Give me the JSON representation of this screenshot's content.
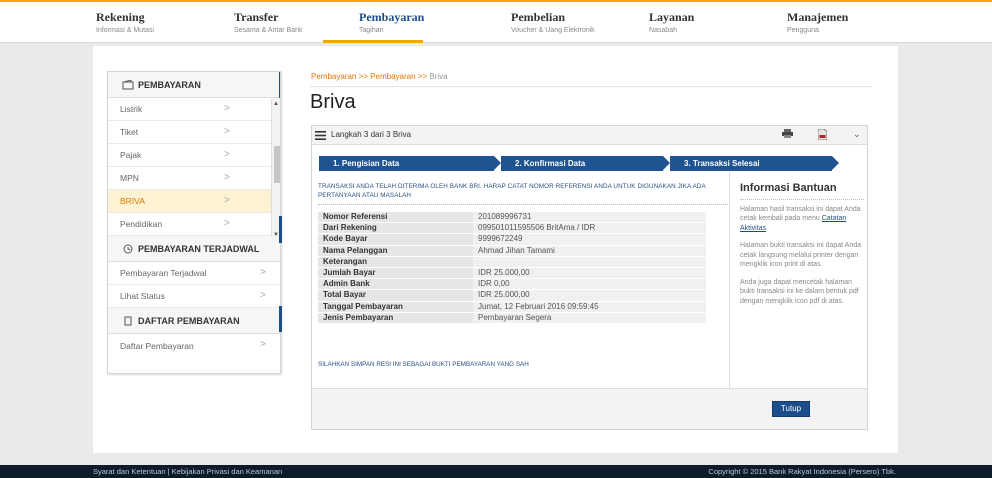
{
  "nav": [
    {
      "title": "Rekening",
      "sub": "Informasi & Mutasi"
    },
    {
      "title": "Transfer",
      "sub": "Sesama & Antar Bank"
    },
    {
      "title": "Pembayaran",
      "sub": "Tagihan"
    },
    {
      "title": "Pembelian",
      "sub": "Voucher & Uang Elektronik"
    },
    {
      "title": "Layanan",
      "sub": "Nasabah"
    },
    {
      "title": "Manajemen",
      "sub": "Pengguna"
    }
  ],
  "sidebar": {
    "pembayaran_header": "PEMBAYARAN",
    "items": [
      {
        "label": "Listrik"
      },
      {
        "label": "Tiket"
      },
      {
        "label": "Pajak"
      },
      {
        "label": "MPN"
      },
      {
        "label": "BRIVA"
      },
      {
        "label": "Pendidikan"
      }
    ],
    "terjadwal_header": "PEMBAYARAN TERJADWAL",
    "terjadwal_items": [
      {
        "label": "Pembayaran Terjadwal"
      },
      {
        "label": "Lihat Status"
      }
    ],
    "daftar_header": "DAFTAR PEMBAYARAN",
    "daftar_items": [
      {
        "label": "Daftar Pembayaran"
      }
    ]
  },
  "breadcrumb": {
    "part1": "Pembayaran",
    "sep1": ">>",
    "part2": "Pembayaran",
    "sep2": ">>",
    "current": "Briva"
  },
  "page_title": "Briva",
  "card": {
    "step_label": "Langkah 3 dari 3 Briva",
    "steps": [
      "1. Pengisian Data",
      "2. Konfirmasi Data",
      "3. Transaksi Selesai"
    ],
    "notice": "Transaksi Anda telah diterima oleh Bank BRI. Harap catat Nomor Referensi Anda untuk digunakan jika ada pertanyaan atau masalah",
    "details": [
      {
        "k": "Nomor Referensi",
        "v": "201089996731"
      },
      {
        "k": "Dari Rekening",
        "v": "099501011595506 BritAma / IDR"
      },
      {
        "k": "Kode Bayar",
        "v": "9999672249"
      },
      {
        "k": "Nama Pelanggan",
        "v": "Ahmad Jihan Tamami"
      },
      {
        "k": "Keterangan",
        "v": ""
      },
      {
        "k": "Jumlah Bayar",
        "v": "IDR 25.000,00"
      },
      {
        "k": "Admin Bank",
        "v": "IDR 0,00"
      },
      {
        "k": "Total Bayar",
        "v": "IDR 25.000,00"
      },
      {
        "k": "Tanggal Pembayaran",
        "v": "Jumat, 12 Februari 2016 09:59:45"
      },
      {
        "k": "Jenis Pembayaran",
        "v": "Pembayaran Segera"
      }
    ],
    "save_note": "Silahkan Simpan Resi ini Sebagai Bukti Pembayaran yang Sah",
    "help_title": "Informasi Bantuan",
    "help_p1": "Halaman hasil transaksi ini dapat Anda cetak kembali pada menu",
    "help_link": "Catatan Aktivitas",
    "help_p2": "Halaman bukti transaksi ini dapat Anda cetak langsung melalui printer dengan mengklik icon print di atas.",
    "help_p3": "Anda juga dapat mencetak halaman bukti transaksi ini ke dalam bentuk pdf dengan mengklik icon pdf di atas.",
    "close_label": "Tutup"
  },
  "footer": {
    "left": "Syarat dan Ketentuan | Kebijakan Privasi dan Keamanan",
    "right": "Copyright © 2015 Bank Rakyat Indonesia (Persero) Tbk."
  },
  "colors": {
    "accent": "#f7a600",
    "primary": "#1c4e8b",
    "footer": "#0d1b2a"
  }
}
